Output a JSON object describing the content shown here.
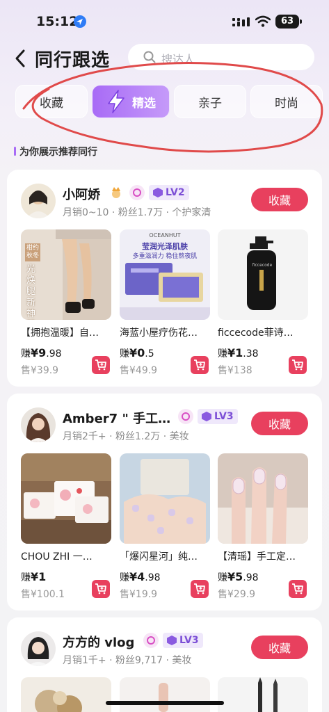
{
  "status": {
    "time": "15:12",
    "battery": "63"
  },
  "header": {
    "title": "同行跟选",
    "search_placeholder": "搜达人"
  },
  "tabs": [
    "收藏",
    "精选",
    "亲子",
    "时尚"
  ],
  "active_tab": "精选",
  "subtitle": "为你展示推荐同行",
  "accent_color": "#e8405e",
  "cards": [
    {
      "name": "小阿娇",
      "level": "LV2",
      "meta": "月销0~10 · 粉丝1.7万 · 个护家清",
      "fav_label": "收藏",
      "products": [
        {
          "name": "【拥抱温暖】自…",
          "earn_prefix": "赚",
          "earn": "¥9",
          "earn_dec": ".98",
          "sale": "售¥39.9",
          "img_text": [
            "柑约",
            "秋冬",
            "光焕",
            "腿新",
            "神器"
          ]
        },
        {
          "name": "海蓝小屋疗伤花…",
          "earn_prefix": "赚",
          "earn": "¥0",
          "earn_dec": ".5",
          "sale": "售¥49.9",
          "img_text": [
            "OCEANHUT",
            "莹润光泽肌肤",
            "多重滋润力 稳住熬夜肌"
          ]
        },
        {
          "name": "ficcecode菲诗…",
          "earn_prefix": "赚",
          "earn": "¥1",
          "earn_dec": ".38",
          "sale": "售¥138",
          "img_text": [
            "ficcecode"
          ]
        }
      ]
    },
    {
      "name": "Amber7 \" 手工…",
      "level": "LV3",
      "meta": "月销2千+ · 粉丝1.2万 · 美妆",
      "fav_label": "收藏",
      "products": [
        {
          "name": "CHOU ZHI 一…",
          "earn_prefix": "赚",
          "earn": "¥1",
          "earn_dec": "",
          "sale": "售¥100.1"
        },
        {
          "name": "「爆闪星河」纯…",
          "earn_prefix": "赚",
          "earn": "¥4",
          "earn_dec": ".98",
          "sale": "售¥19.9"
        },
        {
          "name": "【清瑶】手工定…",
          "earn_prefix": "赚",
          "earn": "¥5",
          "earn_dec": ".98",
          "sale": "售¥29.9"
        }
      ]
    },
    {
      "name": "方方的 vlog",
      "level": "LV3",
      "meta": "月销1千+ · 粉丝9,717 · 美妆",
      "fav_label": "收藏"
    }
  ]
}
